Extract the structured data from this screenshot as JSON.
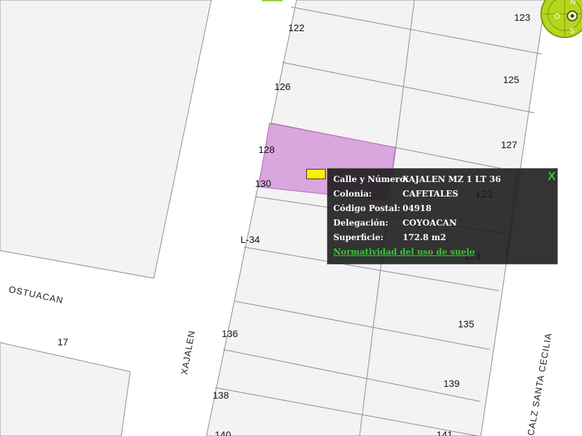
{
  "map": {
    "lot_numbers": [
      "122",
      "123",
      "125",
      "126",
      "127",
      "128",
      "130",
      "L-34",
      "L21",
      "133",
      "135",
      "136",
      "17",
      "138",
      "139",
      "140",
      "141"
    ],
    "streets": [
      "OSTUACAN",
      "XAJALEN",
      "CALZ SANTA CECILIA"
    ]
  },
  "compass": {
    "n": "N",
    "o": "O",
    "s": "S"
  },
  "popup": {
    "close": "X",
    "rows": [
      {
        "key": "Calle y Número:",
        "value": "XAJALEN MZ 1 LT 36"
      },
      {
        "key": "Colonia:",
        "value": "CAFETALES"
      },
      {
        "key": "Código Postal:",
        "value": "04918"
      },
      {
        "key": "Delegación:",
        "value": "COYOACAN"
      },
      {
        "key": "Superficie:",
        "value": "172.8 m2"
      }
    ],
    "link": "Normatividad del uso de suelo"
  },
  "colors": {
    "parcel": "#d9a6dd",
    "block": "#f3f3f3",
    "compass": "#b5d61a",
    "link": "#2ecc2e"
  }
}
